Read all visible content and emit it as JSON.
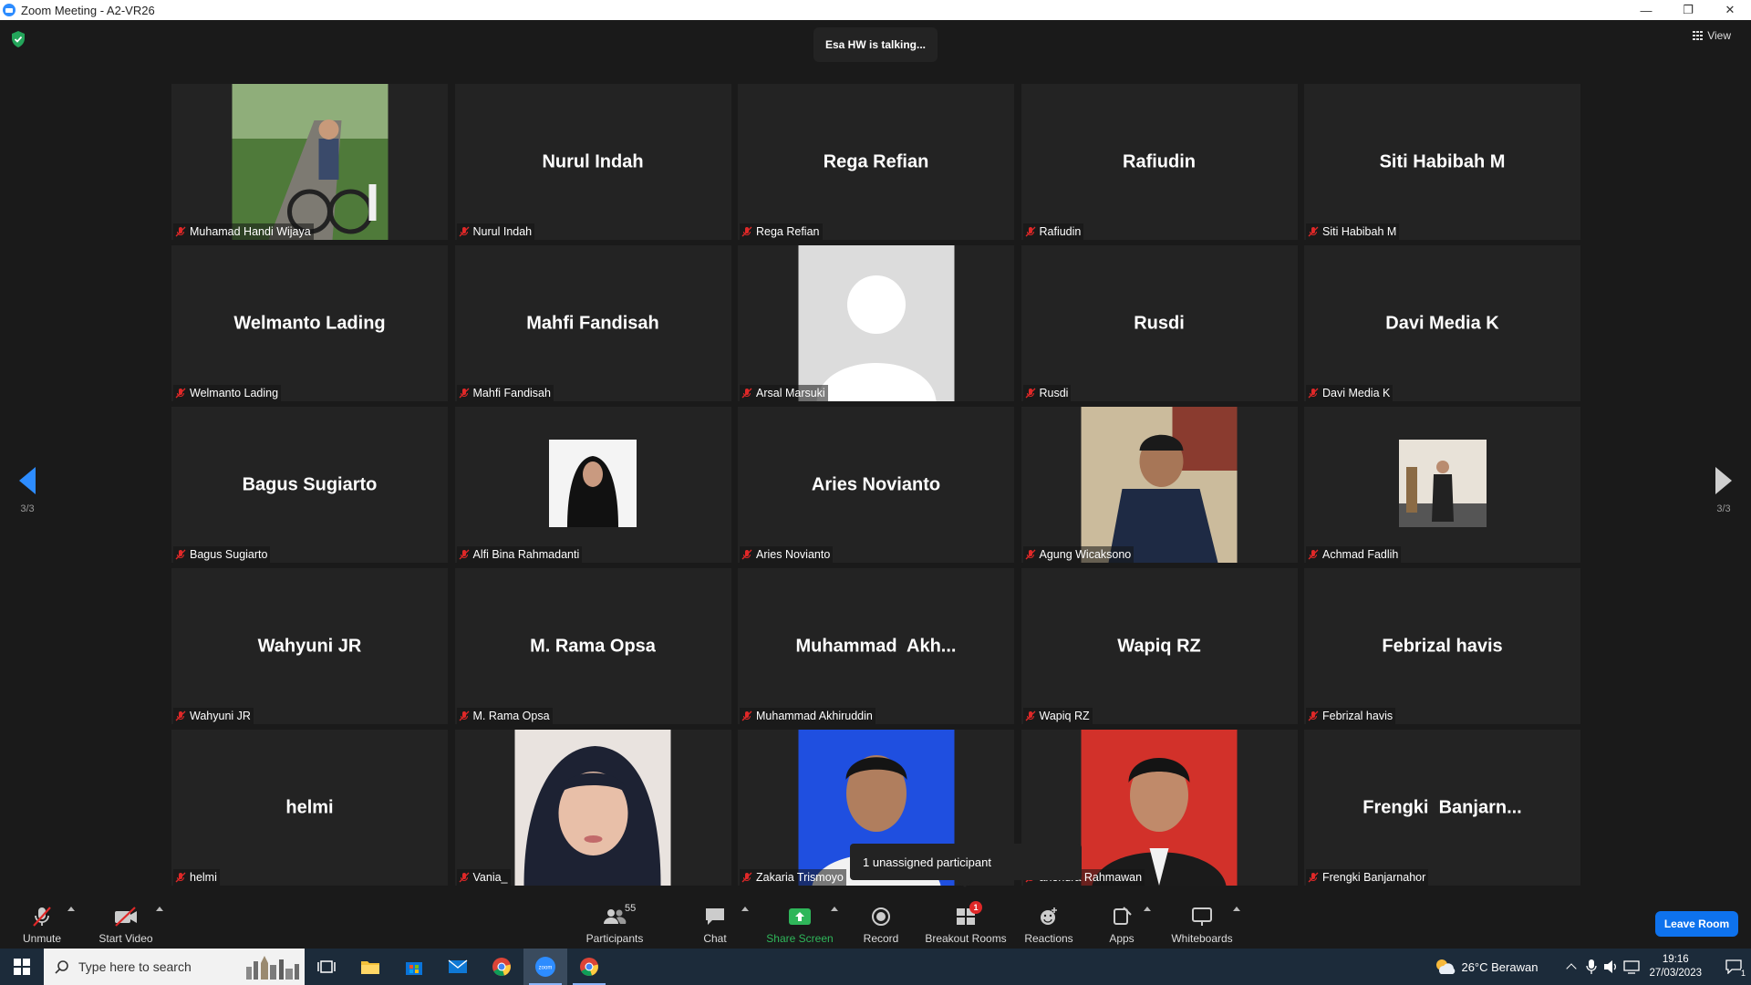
{
  "window": {
    "title": "Zoom Meeting - A2-VR26",
    "controls": [
      "—",
      "❐",
      "✕"
    ]
  },
  "meeting": {
    "talking": "Esa HW is talking...",
    "view_label": "View",
    "page_left": "3/3",
    "page_right": "3/3",
    "unassigned": "1 unassigned participant"
  },
  "tiles": [
    {
      "display": "",
      "label": "Muhamad Handi Wijaya",
      "photo": "cyclist"
    },
    {
      "display": "Nurul Indah",
      "label": "Nurul Indah"
    },
    {
      "display": "Rega Refian",
      "label": "Rega Refian"
    },
    {
      "display": "Rafiudin",
      "label": "Rafiudin"
    },
    {
      "display": "Siti Habibah M",
      "label": "Siti Habibah M"
    },
    {
      "display": "Welmanto Lading",
      "label": "Welmanto Lading"
    },
    {
      "display": "Mahfi Fandisah",
      "label": "Mahfi Fandisah"
    },
    {
      "display": "",
      "label": "Arsal Marsuki",
      "photo": "default-avatar"
    },
    {
      "display": "Rusdi",
      "label": "Rusdi"
    },
    {
      "display": "Davi Media K",
      "label": "Davi Media K"
    },
    {
      "display": "Bagus Sugiarto",
      "label": "Bagus Sugiarto"
    },
    {
      "display": "",
      "label": "Alfi Bina Rahmadanti",
      "photo": "hijab-portrait-small"
    },
    {
      "display": "Aries Novianto",
      "label": "Aries Novianto"
    },
    {
      "display": "",
      "label": "Agung Wicaksono",
      "photo": "man-sitting"
    },
    {
      "display": "",
      "label": "Achmad Fadlih",
      "photo": "man-suit-small"
    },
    {
      "display": "Wahyuni JR",
      "label": "Wahyuni JR"
    },
    {
      "display": "M. Rama Opsa",
      "label": "M. Rama Opsa"
    },
    {
      "display": "Muhammad  Akh...",
      "label": "Muhammad Akhiruddin"
    },
    {
      "display": "Wapiq RZ",
      "label": "Wapiq RZ"
    },
    {
      "display": "Febrizal havis",
      "label": "Febrizal havis"
    },
    {
      "display": "helmi",
      "label": "helmi"
    },
    {
      "display": "",
      "label": "Vania_",
      "photo": "hijab-selfie"
    },
    {
      "display": "",
      "label": "Zakaria Trismoyo",
      "photo": "passport-blue"
    },
    {
      "display": "",
      "label": "ahendra Rahmawan",
      "photo": "passport-red"
    },
    {
      "display": "Frengki  Banjarn...",
      "label": "Frengki Banjarnahor"
    }
  ],
  "toolbar": {
    "unmute": "Unmute",
    "start_video": "Start Video",
    "participants": "Participants",
    "participants_count": "55",
    "chat": "Chat",
    "share_screen": "Share Screen",
    "record": "Record",
    "breakout_rooms": "Breakout Rooms",
    "breakout_badge": "1",
    "reactions": "Reactions",
    "apps": "Apps",
    "whiteboards": "Whiteboards",
    "leave_room": "Leave Room"
  },
  "taskbar": {
    "search_placeholder": "Type here to search",
    "weather": "26°C  Berawan",
    "time": "19:16",
    "date": "27/03/2023",
    "notif_count": "1"
  },
  "colors": {
    "accent": "#2d8cff",
    "share_green": "#2fb65a",
    "muted_red": "#e02828",
    "leave_blue": "#0e72ed",
    "tile_bg": "#232323",
    "bg": "#1a1a1a"
  }
}
